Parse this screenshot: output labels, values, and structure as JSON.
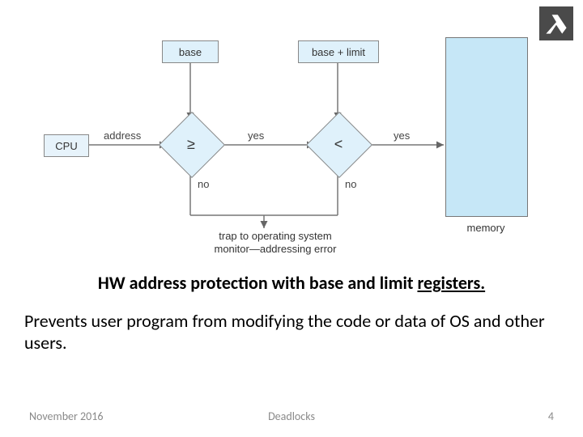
{
  "logo": {
    "name": "technion-aleph-logo"
  },
  "diagram": {
    "cpu": "CPU",
    "base": "base",
    "base_plus_limit": "base + limit",
    "memory": "memory",
    "cmp_ge": "≥",
    "cmp_lt": "<",
    "labels": {
      "address": "address",
      "yes1": "yes",
      "yes2": "yes",
      "no1": "no",
      "no2": "no"
    },
    "trap_line1": "trap to operating system",
    "trap_line2": "monitor—addressing error"
  },
  "title_prefix": "HW address protection with base and limit ",
  "title_underlined": "registers.",
  "paragraph": "Prevents user program from modifying the code or data of OS and other users.",
  "footer": {
    "date": "November 2016",
    "topic": "Deadlocks",
    "page": "4"
  }
}
